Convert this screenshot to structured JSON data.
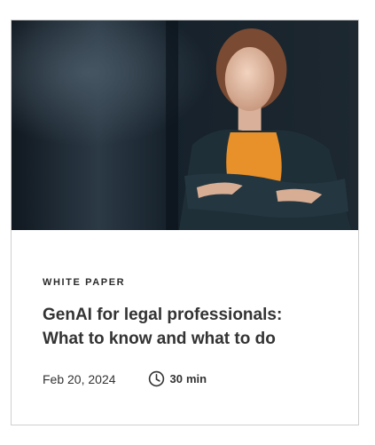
{
  "card": {
    "category": "WHITE PAPER",
    "title_line1": "GenAI for legal professionals:",
    "title_line2": "What to know and what to do",
    "date": "Feb 20, 2024",
    "duration_value": "30",
    "duration_unit": "min"
  },
  "icons": {
    "clock": "clock-icon"
  },
  "colors": {
    "text": "#333333",
    "border": "#cfcfcf",
    "hero_bg": "#1b2530",
    "blouse": "#e8902a"
  }
}
